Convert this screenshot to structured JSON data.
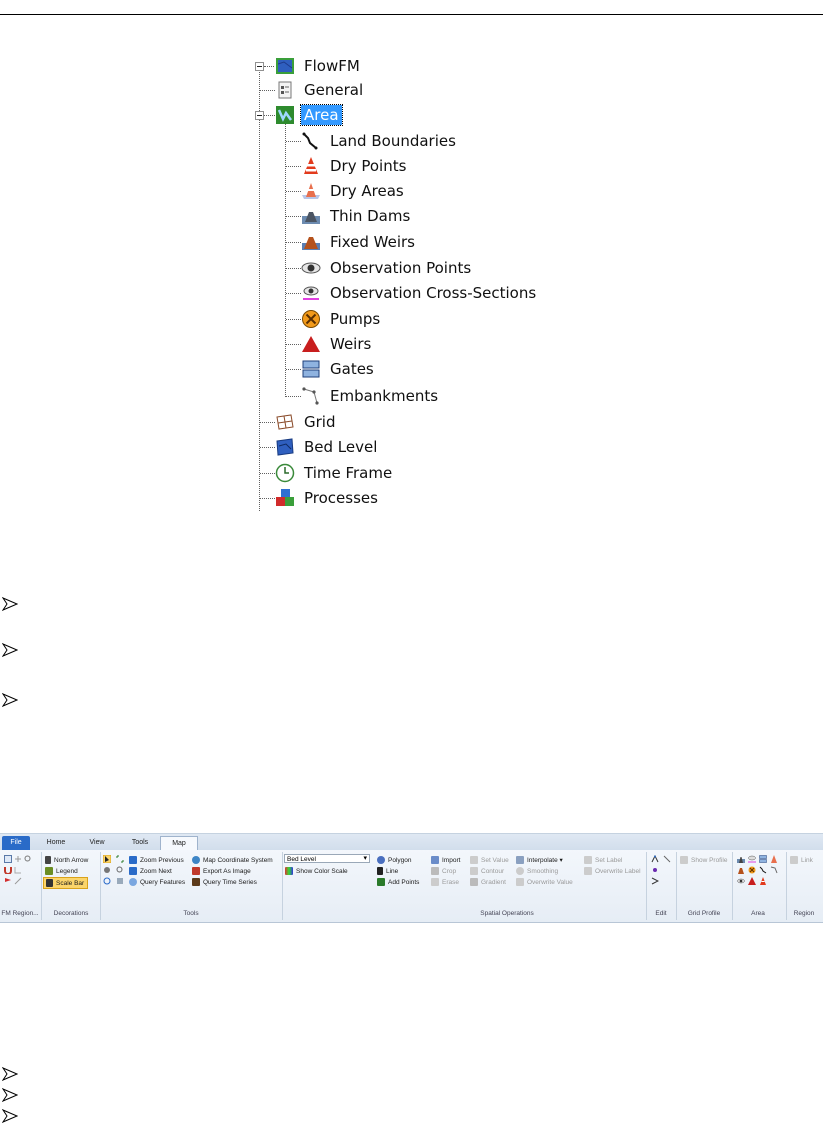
{
  "tree": {
    "root": "FlowFM",
    "children": [
      {
        "label": "General",
        "icon": "document-icon"
      },
      {
        "label": "Area",
        "icon": "area-icon",
        "selected": true,
        "children": [
          {
            "label": "Land Boundaries",
            "icon": "land-boundary-icon"
          },
          {
            "label": "Dry Points",
            "icon": "cone-icon"
          },
          {
            "label": "Dry Areas",
            "icon": "dry-area-icon"
          },
          {
            "label": "Thin Dams",
            "icon": "thin-dam-icon"
          },
          {
            "label": "Fixed Weirs",
            "icon": "fixed-weir-icon"
          },
          {
            "label": "Observation Points",
            "icon": "eye-icon"
          },
          {
            "label": "Observation Cross-Sections",
            "icon": "eye-line-icon"
          },
          {
            "label": "Pumps",
            "icon": "pump-icon"
          },
          {
            "label": "Weirs",
            "icon": "weir-triangle-icon"
          },
          {
            "label": "Gates",
            "icon": "gate-icon"
          },
          {
            "label": "Embankments",
            "icon": "embankment-icon"
          }
        ]
      },
      {
        "label": "Grid",
        "icon": "grid-icon"
      },
      {
        "label": "Bed Level",
        "icon": "bed-level-icon"
      },
      {
        "label": "Time Frame",
        "icon": "clock-icon"
      },
      {
        "label": "Processes",
        "icon": "processes-icon"
      }
    ]
  },
  "ribbon": {
    "tabs": [
      "File",
      "Home",
      "View",
      "Tools",
      "Map"
    ],
    "active_tab": "Map",
    "groups": [
      "FM Region...",
      "Decorations",
      "Tools",
      "Spatial Operations",
      "Edit",
      "Grid Profile",
      "Area",
      "Region"
    ],
    "decorations": [
      "North Arrow",
      "Legend",
      "Scale Bar"
    ],
    "tools": [
      "Zoom Previous",
      "Zoom Next",
      "Query Features",
      "Map Coordinate System",
      "Export As Image",
      "Query Time Series"
    ],
    "coverage_select": "Bed Level",
    "show_color_scale": "Show Color Scale",
    "spatial": [
      "Polygon",
      "Line",
      "Add Points",
      "Import",
      "Crop",
      "Erase",
      "Set Value",
      "Contour",
      "Gradient",
      "Interpolate ▾",
      "Smoothing",
      "Overwrite Value",
      "Set Label",
      "Overwrite Label"
    ],
    "show_profile": "Show Profile",
    "link": "Link",
    "accent": "#2a6bc8"
  }
}
